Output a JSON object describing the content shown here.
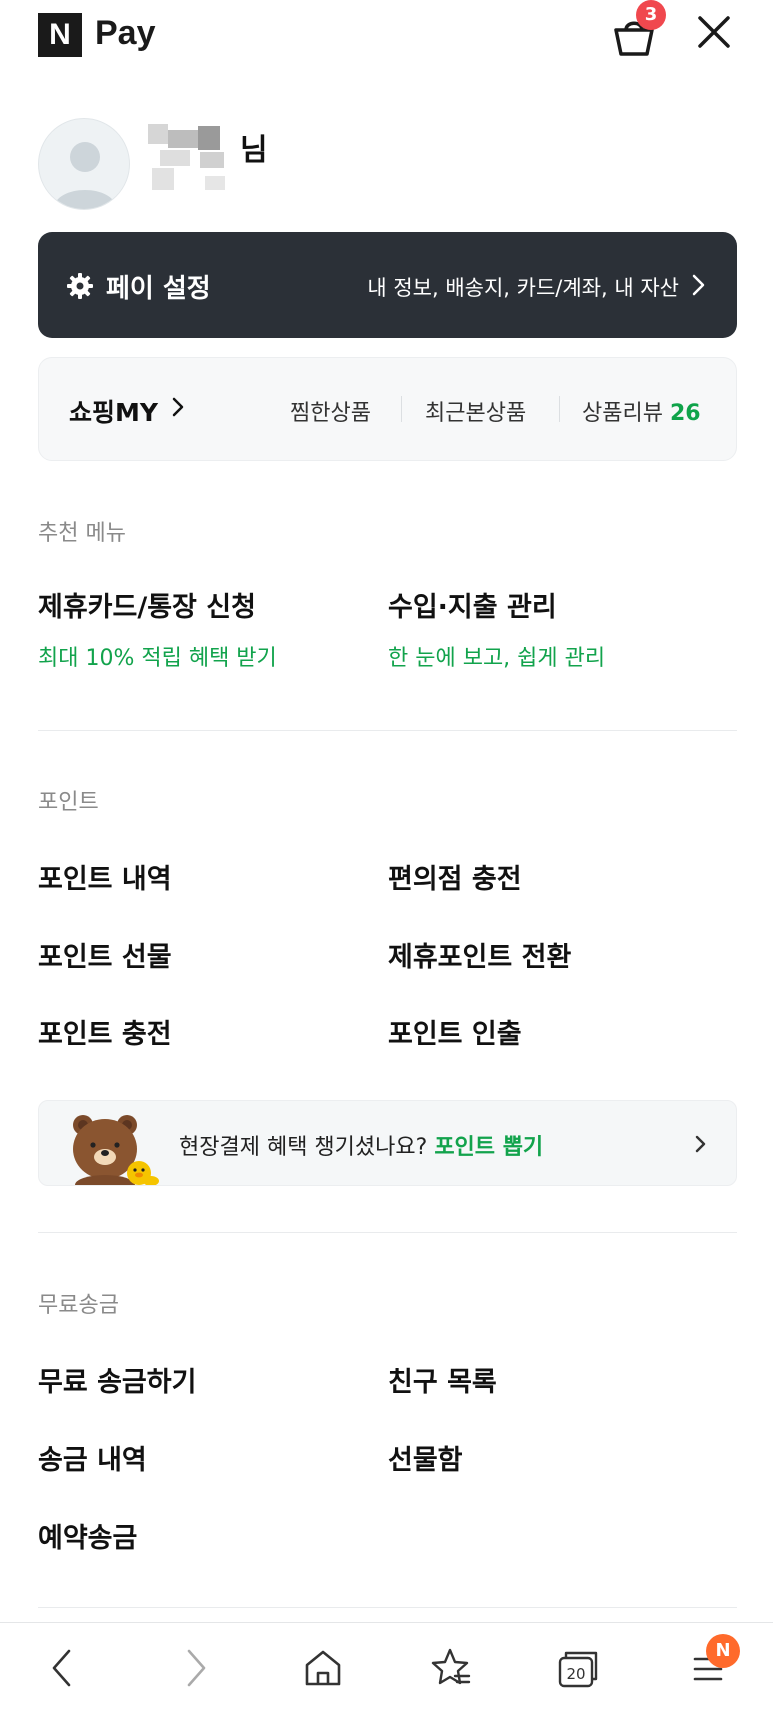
{
  "header": {
    "logo_letter": "N",
    "logo_text": "Pay",
    "cart_count": "3"
  },
  "profile": {
    "name_suffix": "님"
  },
  "pay_settings": {
    "title": "페이 설정",
    "links": "내 정보, 배송지, 카드/계좌, 내 자산"
  },
  "shopping": {
    "title": "쇼핑MY",
    "links": [
      "찜한상품",
      "최근본상품"
    ],
    "review_label": "상품리뷰",
    "review_count": "26"
  },
  "recommended": {
    "label": "추천 메뉴",
    "items": [
      {
        "title": "제휴카드/통장 신청",
        "subtitle": "최대 10% 적립 혜택 받기"
      },
      {
        "title": "수입·지출 관리",
        "subtitle": "한 눈에 보고, 쉽게 관리"
      }
    ]
  },
  "points": {
    "label": "포인트",
    "items": [
      "포인트 내역",
      "편의점 충전",
      "포인트 선물",
      "제휴포인트 전환",
      "포인트 충전",
      "포인트 인출"
    ],
    "banner_text": "현장결제 혜택 챙기셨나요?",
    "banner_link": "포인트 뽑기"
  },
  "transfer": {
    "label": "무료송금",
    "items": [
      "무료 송금하기",
      "친구 목록",
      "송금 내역",
      "선물함",
      "예약송금"
    ]
  },
  "bottom_nav": {
    "tab_count": "20",
    "menu_badge": "N"
  },
  "colors": {
    "accent_green": "#12a34c",
    "dark_panel": "#2b3037",
    "badge_red": "#f0484e",
    "badge_orange": "#ff6a2b"
  }
}
